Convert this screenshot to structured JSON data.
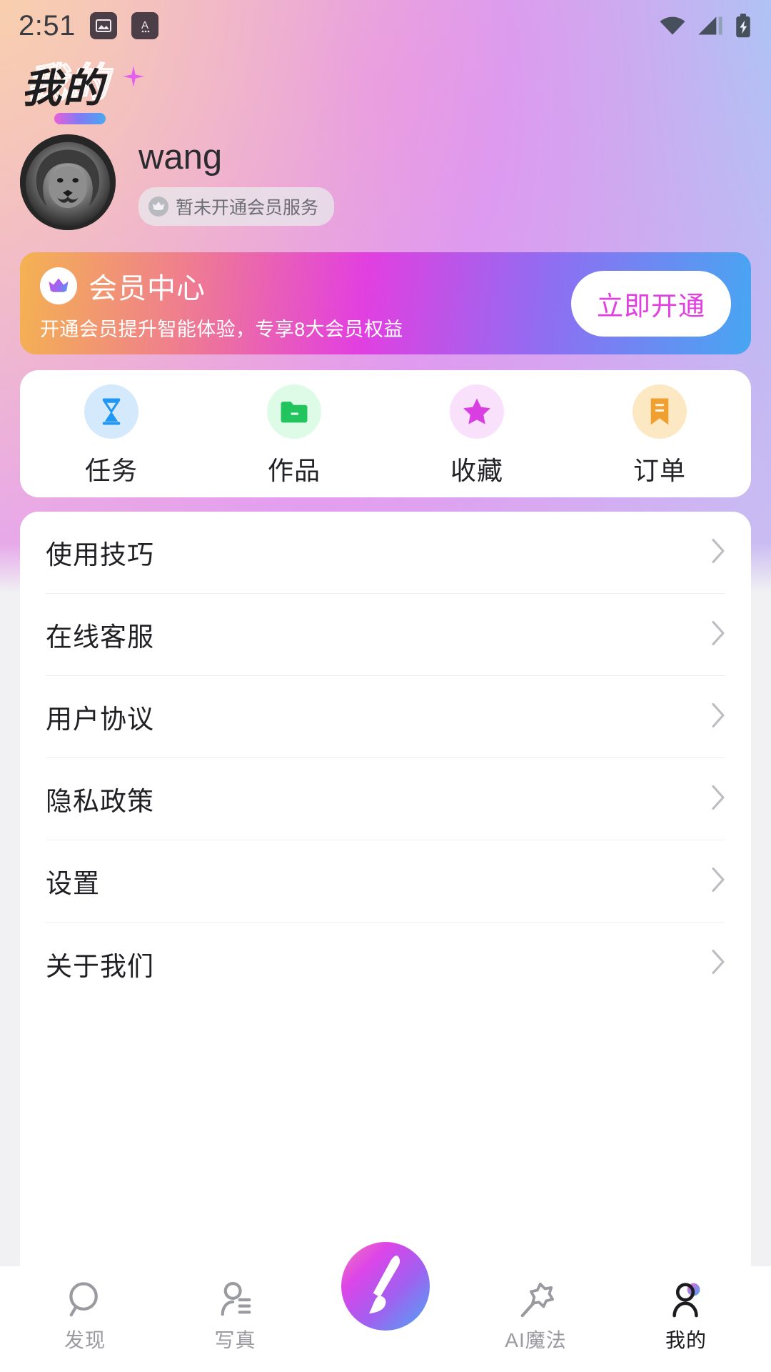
{
  "status_bar": {
    "time": "2:51",
    "left_icons": [
      "image-icon",
      "app-a-icon"
    ],
    "right_icons": [
      "wifi-icon",
      "cellular-signal-icon",
      "battery-charging-icon"
    ]
  },
  "header": {
    "title": "我的",
    "sparkle": "sparkle-icon"
  },
  "profile": {
    "avatar": "lion-avatar",
    "username": "wang",
    "membership_badge": {
      "icon": "crown-icon",
      "text": "暂未开通会员服务"
    }
  },
  "vip_banner": {
    "icon": "crown-icon",
    "title": "会员中心",
    "subtitle": "开通会员提升智能体验，专享8大会员权益",
    "cta_label": "立即开通",
    "cta_text_color": "#e23fe0",
    "gradient": [
      "#f4b251",
      "#ef7f8d",
      "#e23fe0",
      "#8f6ef2",
      "#47a6f2"
    ]
  },
  "quick_actions": [
    {
      "label": "任务",
      "icon": "hourglass-icon",
      "icon_color": "#2196f3",
      "bg_color": "#d4e9fb"
    },
    {
      "label": "作品",
      "icon": "folder-icon",
      "icon_color": "#21c45d",
      "bg_color": "#ddfbe7"
    },
    {
      "label": "收藏",
      "icon": "star-icon",
      "icon_color": "#d githubmagenta",
      "bg_color": "#f9e0fb"
    },
    {
      "label": "订单",
      "icon": "bookmark-icon",
      "icon_color": "#f0a030",
      "bg_color": "#fde8c4"
    }
  ],
  "menu": {
    "items": [
      {
        "label": "使用技巧",
        "chevron": "chevron-right-icon"
      },
      {
        "label": "在线客服",
        "chevron": "chevron-right-icon"
      },
      {
        "label": "用户协议",
        "chevron": "chevron-right-icon"
      },
      {
        "label": "隐私政策",
        "chevron": "chevron-right-icon"
      },
      {
        "label": "设置",
        "chevron": "chevron-right-icon"
      },
      {
        "label": "关于我们",
        "chevron": "chevron-right-icon"
      }
    ]
  },
  "bottom_nav": {
    "items": [
      {
        "label": "发现",
        "icon": "search-icon",
        "active": false
      },
      {
        "label": "写真",
        "icon": "portrait-person-icon",
        "active": false
      },
      {
        "label": "AI魔法",
        "icon": "magic-wand-star-icon",
        "active": false
      },
      {
        "label": "我的",
        "icon": "profile-person-icon",
        "active": true
      }
    ],
    "center_button": {
      "icon": "paintbrush-icon"
    }
  }
}
